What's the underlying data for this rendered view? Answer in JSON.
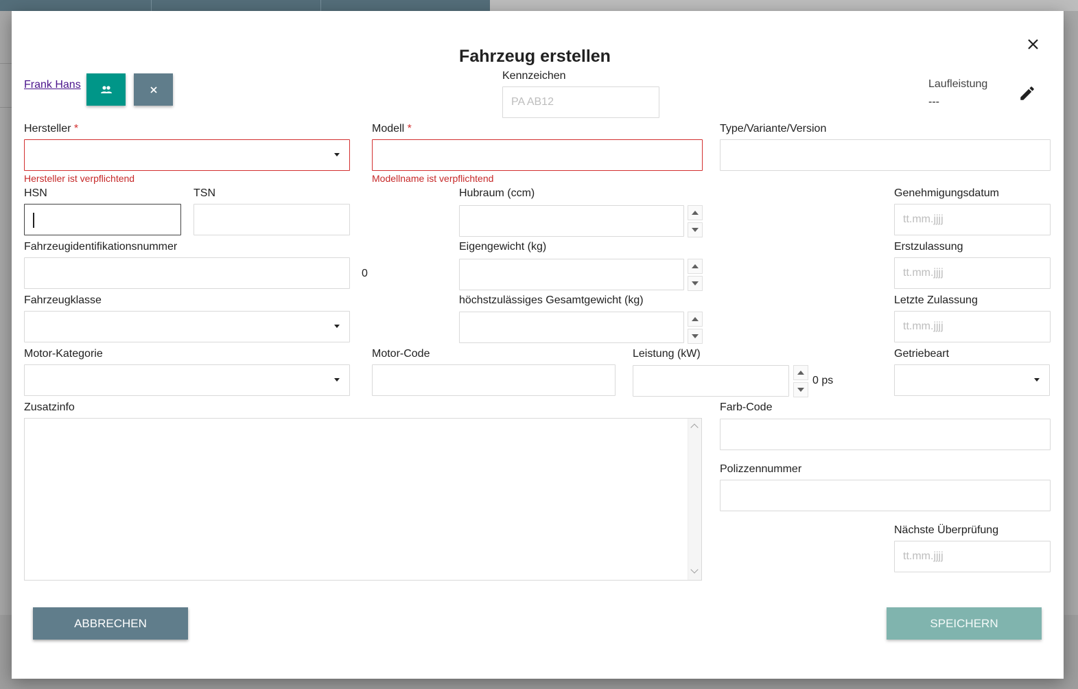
{
  "dialog": {
    "title": "Fahrzeug erstellen",
    "customer_name": "Frank Hans",
    "cancel_label": "ABBRECHEN",
    "save_label": "SPEICHERN"
  },
  "fields": {
    "kennzeichen": {
      "label": "Kennzeichen",
      "placeholder": "PA AB12"
    },
    "laufleistung": {
      "label": "Laufleistung",
      "value": "---"
    },
    "hersteller": {
      "label": "Hersteller",
      "required_mark": "*",
      "error": "Hersteller ist verpflichtend"
    },
    "modell": {
      "label": "Modell",
      "required_mark": "*",
      "error": "Modellname ist verpflichtend"
    },
    "type": {
      "label": "Type/Variante/Version"
    },
    "hsn": {
      "label": "HSN"
    },
    "tsn": {
      "label": "TSN"
    },
    "hubraum": {
      "label": "Hubraum (ccm)"
    },
    "genehmigungsdatum": {
      "label": "Genehmigungsdatum",
      "placeholder": "tt.mm.jjjj"
    },
    "fin": {
      "label": "Fahrzeugidentifikationsnummer",
      "counter": "0"
    },
    "eigengewicht": {
      "label": "Eigengewicht (kg)"
    },
    "erstzulassung": {
      "label": "Erstzulassung",
      "placeholder": "tt.mm.jjjj"
    },
    "fahrzeugklasse": {
      "label": "Fahrzeugklasse"
    },
    "gesamtgewicht": {
      "label": "höchstzulässiges Gesamtgewicht (kg)"
    },
    "letzte_zulassung": {
      "label": "Letzte Zulassung",
      "placeholder": "tt.mm.jjjj"
    },
    "motor_kategorie": {
      "label": "Motor-Kategorie"
    },
    "motor_code": {
      "label": "Motor-Code"
    },
    "leistung": {
      "label": "Leistung (kW)",
      "ps_text": "0 ps"
    },
    "getriebeart": {
      "label": "Getriebeart"
    },
    "zusatzinfo": {
      "label": "Zusatzinfo"
    },
    "farb_code": {
      "label": "Farb-Code"
    },
    "polizzennummer": {
      "label": "Polizzennummer"
    },
    "naechste_ueberpruefung": {
      "label": "Nächste Überprüfung",
      "placeholder": "tt.mm.jjjj"
    }
  },
  "colors": {
    "primary": "#009688",
    "secondary": "#607d8b",
    "error": "#d32f2f",
    "save_disabled": "#80b4ae"
  },
  "icons": {
    "close": "close-icon",
    "people": "people-icon",
    "remove": "close-icon",
    "edit": "pencil-icon"
  }
}
